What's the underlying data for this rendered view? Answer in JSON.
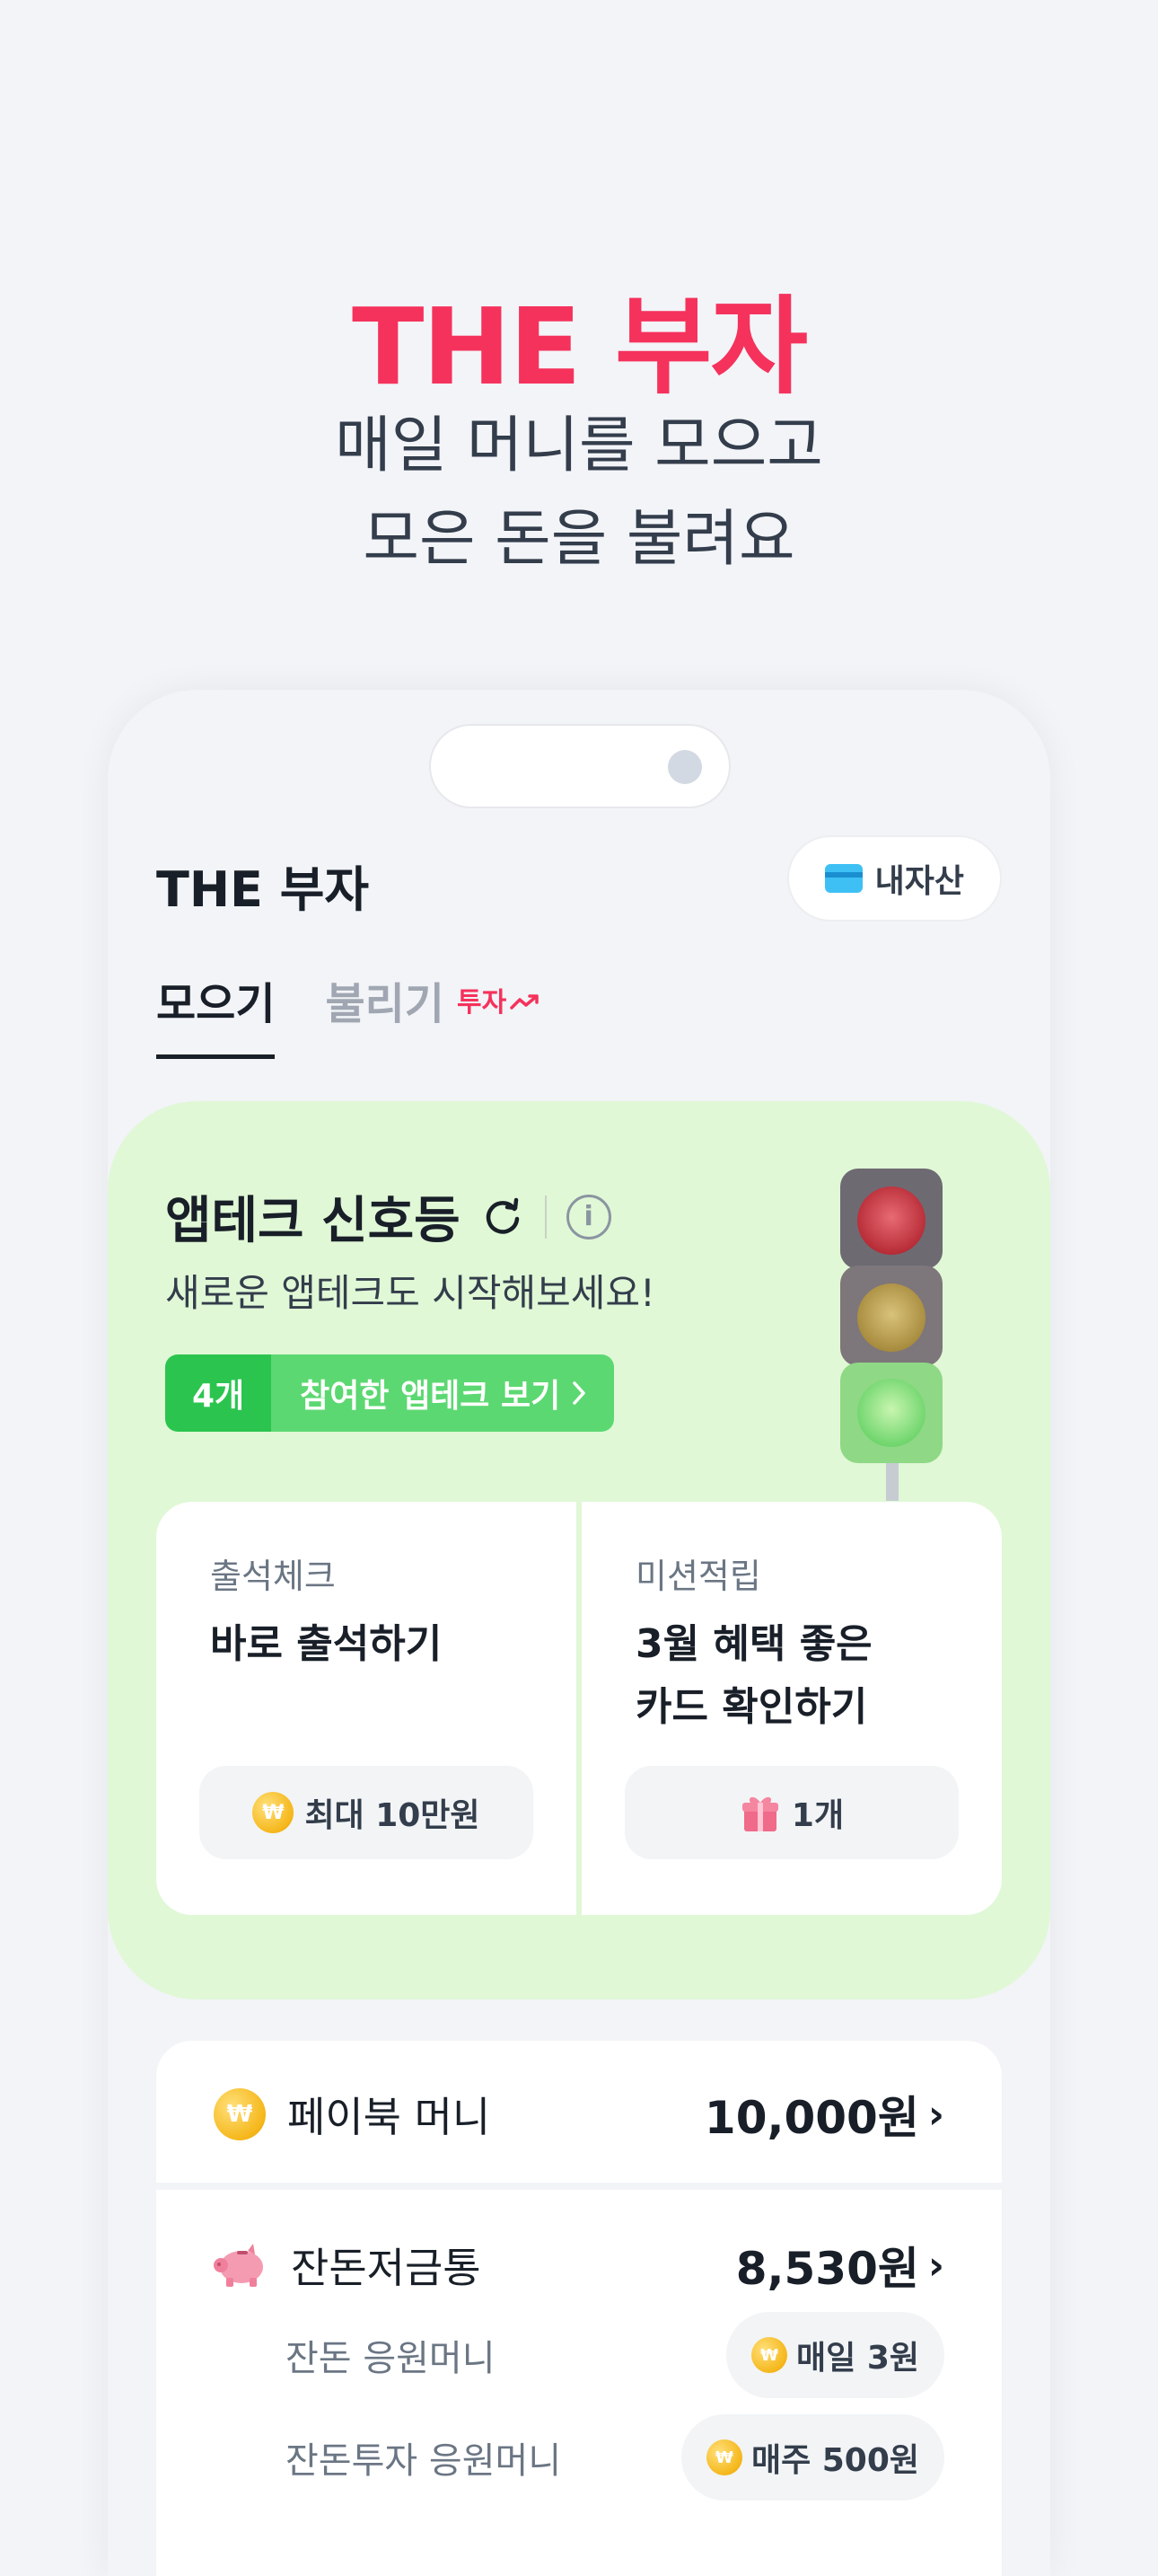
{
  "hero": {
    "title": "THE 부자",
    "subtitle_line1": "매일 머니를 모으고",
    "subtitle_line2": "모은 돈을 불려요"
  },
  "header": {
    "app_title": "THE 부자",
    "asset_button_label": "내자산"
  },
  "tabs": [
    {
      "label": "모으기",
      "active": true
    },
    {
      "label": "불리기",
      "active": false,
      "badge": "투자"
    }
  ],
  "apptech": {
    "title": "앱테크 신호등",
    "subtitle": "새로운 앱테크도 시작해보세요!",
    "joined_count": "4개",
    "joined_label": "참여한 앱테크 보기",
    "cards": [
      {
        "category": "출석체크",
        "title_line1": "바로 출석하기",
        "title_line2": "",
        "reward": "최대 10만원",
        "reward_icon": "coin-icon"
      },
      {
        "category": "미션적립",
        "title_line1": "3월 혜택 좋은",
        "title_line2": "카드 확인하기",
        "reward": "1개",
        "reward_icon": "gift-icon"
      }
    ]
  },
  "list": {
    "paybook": {
      "label": "페이북 머니",
      "value": "10,000원"
    },
    "piggy": {
      "label": "잔돈저금통",
      "value": "8,530원"
    },
    "sub_rows": [
      {
        "label": "잔돈 응원머니",
        "pill": "매일 3원"
      },
      {
        "label": "잔돈투자 응원머니",
        "pill": "매주 500원"
      }
    ]
  },
  "colors": {
    "brand_red": "#f5325c",
    "green_panel": "#e0f8d6",
    "green_pill": "#2bc44f"
  }
}
